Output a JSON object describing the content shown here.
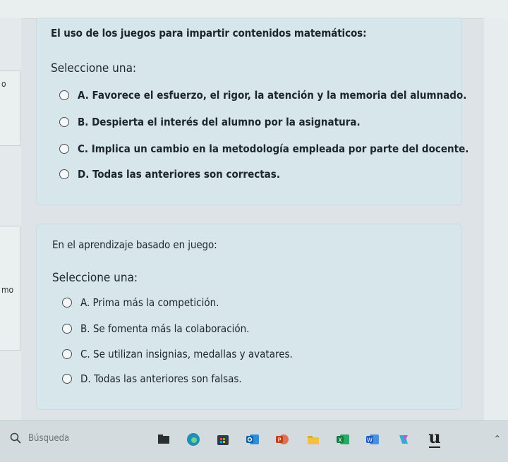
{
  "questions": [
    {
      "text": "El uso de los juegos para impartir contenidos matemáticos:",
      "select_label": "Seleccione una:",
      "options": [
        "A. Favorece el esfuerzo, el rigor, la atención y la memoria del alumnado.",
        "B. Despierta el interés del alumno por la asignatura.",
        "C. Implica un cambio en la metodología empleada por parte del docente.",
        "D. Todas las anteriores son correctas."
      ]
    },
    {
      "text": "En el aprendizaje basado en juego:",
      "select_label": "Seleccione una:",
      "options": [
        "A. Prima más la competición.",
        "B. Se fomenta más la colaboración.",
        "C. Se utilizan insignias, medallas y avatares.",
        "D. Todas las anteriores son falsas."
      ]
    }
  ],
  "edge_text": {
    "top": "o",
    "bottom": "mo"
  },
  "taskbar": {
    "search_placeholder": "Búsqueda",
    "icons": [
      "file-explorer-icon",
      "edge-icon",
      "store-icon",
      "outlook-icon",
      "powerpoint-icon",
      "files-icon",
      "excel-icon",
      "word-icon",
      "copilot-icon",
      "u-app-icon"
    ],
    "pinned_letter": "u"
  }
}
